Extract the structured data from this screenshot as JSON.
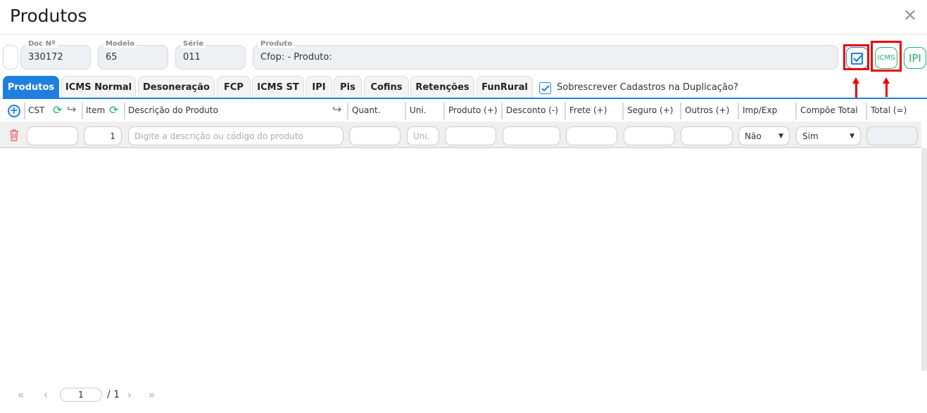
{
  "header": {
    "title": "Produtos"
  },
  "fields": {
    "doc": {
      "label": "Doc Nº",
      "value": "330172"
    },
    "modelo": {
      "label": "Modelo",
      "value": "65"
    },
    "serie": {
      "label": "Série",
      "value": "011"
    },
    "produto": {
      "label": "Produto",
      "value": "Cfop:  - Produto:"
    }
  },
  "action_buttons": {
    "icms": "ICMS",
    "ipi": "IPI"
  },
  "tabs": [
    "Produtos",
    "ICMS Normal",
    "Desoneração",
    "FCP",
    "ICMS ST",
    "IPI",
    "Pis",
    "Cofins",
    "Retenções",
    "FunRural"
  ],
  "overwrite_checkbox": {
    "label": "Sobrescrever Cadastros na Duplicação?",
    "checked": true
  },
  "columns": [
    "CST",
    "Item",
    "Descrição do Produto",
    "Quant.",
    "Uni.",
    "Produto (+)",
    "Desconto (-)",
    "Frete (+)",
    "Seguro (+)",
    "Outros (+)",
    "Imp/Exp",
    "Compõe Total",
    "Total (=)"
  ],
  "row": {
    "item": "1",
    "desc_placeholder": "Digite a descrição ou código do produto",
    "uni_placeholder": "Uni.",
    "imp_exp": "Não",
    "compoe_total": "Sim"
  },
  "pagination": {
    "page": "1",
    "total": "/ 1"
  },
  "colors": {
    "accent": "#1e7fe0",
    "green": "#1bb36b",
    "red": "#e00000"
  }
}
